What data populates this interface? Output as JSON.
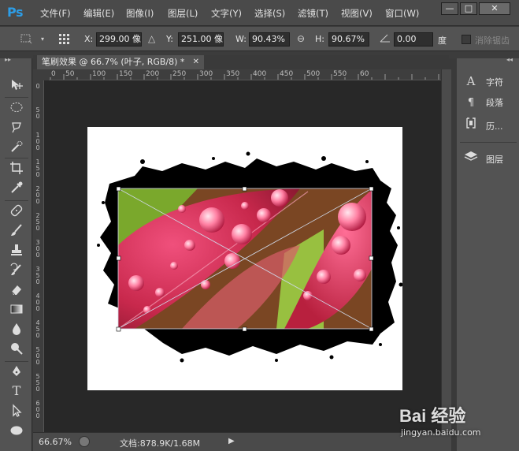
{
  "app": {
    "logo_text": "Ps"
  },
  "menu": {
    "items": [
      "文件(F)",
      "编辑(E)",
      "图像(I)",
      "图层(L)",
      "文字(Y)",
      "选择(S)",
      "滤镜(T)",
      "视图(V)",
      "窗口(W)"
    ],
    "window_controls": {
      "minimize": "—",
      "restore": "□",
      "close": "✕"
    }
  },
  "options": {
    "x_label": "X:",
    "x_value": "299.00 像",
    "y_label": "Y:",
    "y_value": "251.00 像",
    "w_label": "W:",
    "w_value": "90.43%",
    "h_label": "H:",
    "h_value": "90.67%",
    "angle_value": "0.00",
    "angle_unit": "度",
    "antialias_label": "消除锯齿"
  },
  "document": {
    "tab_title": "笔刷效果 @ 66.7% (叶子, RGB/8) *",
    "tab_close": "✕"
  },
  "rulers": {
    "horizontal": [
      "50",
      "0",
      "50",
      "100",
      "150",
      "200",
      "250",
      "300",
      "350",
      "400",
      "450",
      "500",
      "550",
      "60"
    ],
    "vertical": [
      "0",
      "50",
      "100",
      "150",
      "200",
      "250",
      "300",
      "350",
      "400",
      "450",
      "500",
      "550",
      "600"
    ]
  },
  "status": {
    "zoom": "66.67%",
    "doc_info": "文档:878.9K/1.68M"
  },
  "panels": {
    "items": [
      {
        "icon": "character-icon",
        "label": "字符"
      },
      {
        "icon": "paragraph-icon",
        "label": "段落"
      },
      {
        "icon": "history-icon",
        "label": "历..."
      },
      {
        "icon": "layers-icon",
        "label": "图层"
      }
    ]
  },
  "watermark": {
    "logo": "Bai 经验",
    "url": "jingyan.baidu.com"
  },
  "colors": {
    "ps_blue": "#2d9de6",
    "panel_bg": "#535353",
    "canvas_bg": "#282828"
  }
}
